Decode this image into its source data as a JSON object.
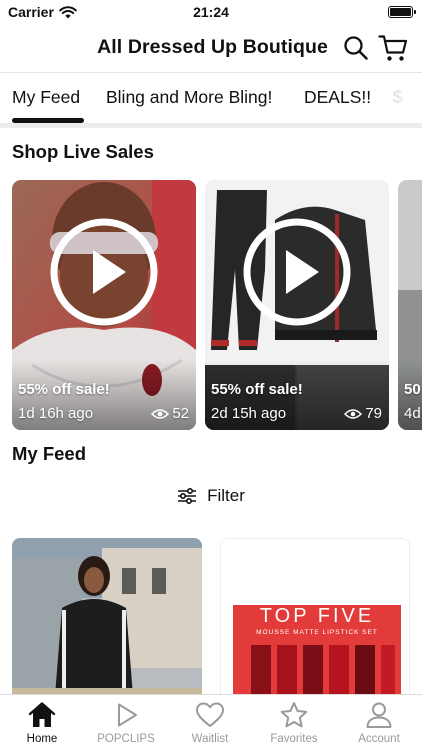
{
  "status": {
    "carrier": "Carrier",
    "time": "21:24"
  },
  "header": {
    "title": "All Dressed Up Boutique"
  },
  "tabs": [
    {
      "label": "My Feed",
      "active": true
    },
    {
      "label": "Bling and More Bling!",
      "active": false
    },
    {
      "label": "DEALS!!",
      "active": false
    },
    {
      "label": "$",
      "active": false
    }
  ],
  "live_sales": {
    "title": "Shop Live Sales",
    "items": [
      {
        "label": "55% off sale!",
        "time": "1d 16h ago",
        "views": "52"
      },
      {
        "label": "55% off sale!",
        "time": "2d 15h ago",
        "views": "79"
      },
      {
        "label": "50",
        "time": "4d",
        "views": ""
      }
    ]
  },
  "feed": {
    "title": "My Feed",
    "filter_label": "Filter",
    "product_brand": "TOP FIVE",
    "product_line": "MOUSSE MATTE LIPSTICK SET"
  },
  "bottom_nav": [
    {
      "label": "Home",
      "icon": "home-icon",
      "active": true
    },
    {
      "label": "POPCLIPS",
      "icon": "play-icon",
      "active": false
    },
    {
      "label": "Waitlist",
      "icon": "heart-icon",
      "active": false
    },
    {
      "label": "Favorites",
      "icon": "star-icon",
      "active": false
    },
    {
      "label": "Account",
      "icon": "person-icon",
      "active": false
    }
  ],
  "colors": {
    "accent": "#111111",
    "inactive": "#9a9a9a",
    "product_red": "#e33a3a"
  }
}
